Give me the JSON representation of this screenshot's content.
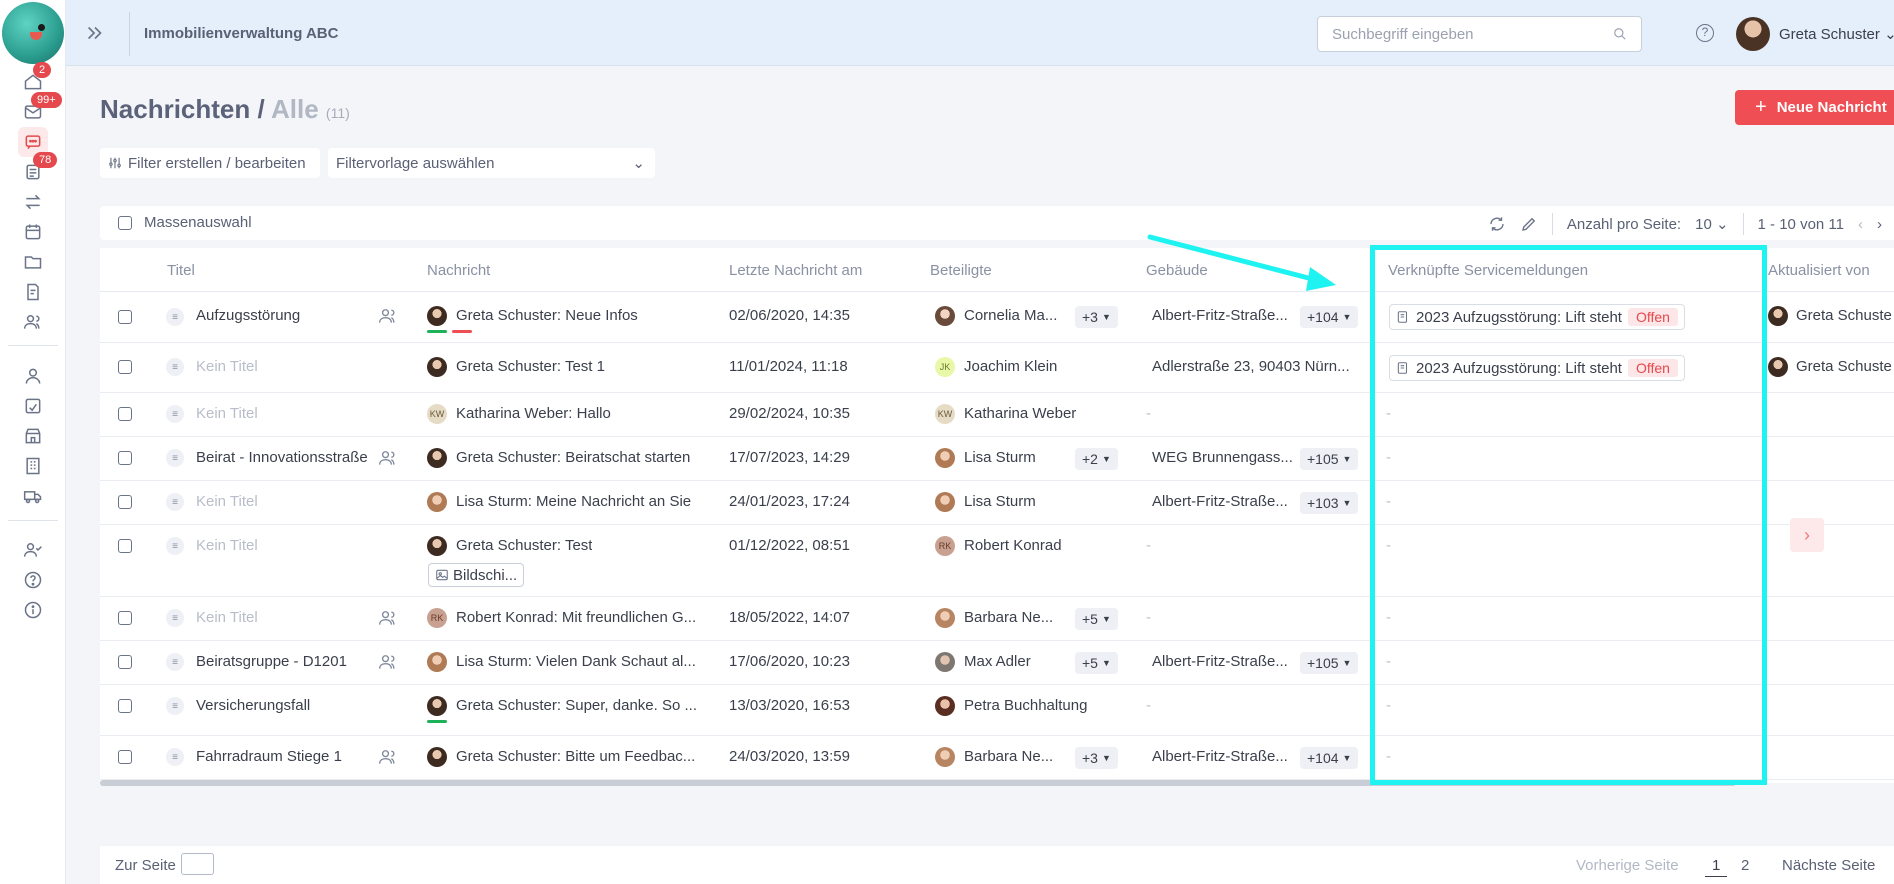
{
  "app": {
    "title": "Immobilienverwaltung ABC",
    "search_placeholder": "Suchbegriff eingeben",
    "user_name": "Greta Schuster",
    "help": "?"
  },
  "sidebar": {
    "badges": {
      "home": "2",
      "mail": "99+",
      "tasks": "78"
    }
  },
  "header": {
    "title": "Nachrichten",
    "separator": " / ",
    "subtitle": "Alle",
    "count": "(11)",
    "new_button": "Neue Nachricht",
    "filter_button": "Filter erstellen / bearbeiten",
    "filter_select": "Filtervorlage auswählen"
  },
  "toolbar": {
    "mass_select": "Massenauswahl",
    "per_page_label": "Anzahl pro Seite:",
    "per_page_value": "10",
    "range": "1 - 10 von 11"
  },
  "columns": {
    "title": "Titel",
    "message": "Nachricht",
    "last": "Letzte Nachricht am",
    "participants": "Beteiligte",
    "building": "Gebäude",
    "linked": "Verknüpfte Servicemeldungen",
    "updated_by": "Aktualisiert von"
  },
  "rows": [
    {
      "title": "Aufzugsstörung",
      "sender": "Greta Schuster",
      "msg": "Neue Infos",
      "date": "02/06/2020, 14:35",
      "participant": "Cornelia Ma...",
      "p_more": "+3",
      "building": "Albert-Fritz-Straße...",
      "b_more": "+104",
      "service": "2023 Aufzugsstörung: Lift steht",
      "status": "Offen",
      "updated_by": "Greta Schuste",
      "dash": "-"
    },
    {
      "title": "Kein Titel",
      "sender": "Greta Schuster",
      "msg": "Test 1",
      "date": "11/01/2024, 11:18",
      "participant": "Joachim Klein",
      "building": "Adlerstraße 23, 90403 Nürn...",
      "service": "2023 Aufzugsstörung: Lift steht",
      "status": "Offen",
      "updated_by": "Greta Schuste",
      "initials": "JK"
    },
    {
      "title": "Kein Titel",
      "sender": "Katharina Weber",
      "msg": "Hallo",
      "date": "29/02/2024, 10:35",
      "participant": "Katharina Weber",
      "initials": "KW",
      "dash": "-"
    },
    {
      "title": "Beirat - Innovationsstraße",
      "sender": "Greta Schuster",
      "msg": "Beiratschat starten",
      "date": "17/07/2023, 14:29",
      "participant": "Lisa Sturm",
      "p_more": "+2",
      "building": "WEG Brunnengass...",
      "b_more": "+105",
      "dash": "-"
    },
    {
      "title": "Kein Titel",
      "sender": "Lisa Sturm",
      "msg": "Meine Nachricht an Sie",
      "date": "24/01/2023, 17:24",
      "participant": "Lisa Sturm",
      "building": "Albert-Fritz-Straße...",
      "b_more": "+103",
      "dash": "-"
    },
    {
      "title": "Kein Titel",
      "sender": "Greta Schuster",
      "msg": "Test",
      "attachment": "Bildschi...",
      "date": "01/12/2022, 08:51",
      "participant": "Robert Konrad",
      "initials": "RK",
      "dash": "-"
    },
    {
      "title": "Kein Titel",
      "sender": "Robert Konrad",
      "msg": "Mit freundlichen G...",
      "date": "18/05/2022, 14:07",
      "participant": "Barbara Ne...",
      "p_more": "+5",
      "initials": "RK",
      "dash": "-"
    },
    {
      "title": "Beiratsgruppe - D1201",
      "sender": "Lisa Sturm",
      "msg": "Vielen Dank Schaut al...",
      "date": "17/06/2020, 10:23",
      "participant": "Max Adler",
      "p_more": "+5",
      "building": "Albert-Fritz-Straße...",
      "b_more": "+105",
      "dash": "-"
    },
    {
      "title": "Versicherungsfall",
      "sender": "Greta Schuster",
      "msg": "Super, danke. So ...",
      "date": "13/03/2020, 16:53",
      "participant": "Petra Buchhaltung",
      "dash": "-"
    },
    {
      "title": "Fahrradraum Stiege 1",
      "sender": "Greta Schuster",
      "msg": "Bitte um Feedbac...",
      "date": "24/03/2020, 13:59",
      "participant": "Barbara Ne...",
      "p_more": "+3",
      "building": "Albert-Fritz-Straße...",
      "b_more": "+104",
      "dash": "-"
    }
  ],
  "footer": {
    "goto_label": "Zur Seite",
    "prev": "Vorherige Seite",
    "page1": "1",
    "page2": "2",
    "next": "Nächste Seite"
  },
  "colors": {
    "accent": "#ef4f54",
    "highlight": "#1ff3f2",
    "status_open": "#e5484d"
  }
}
